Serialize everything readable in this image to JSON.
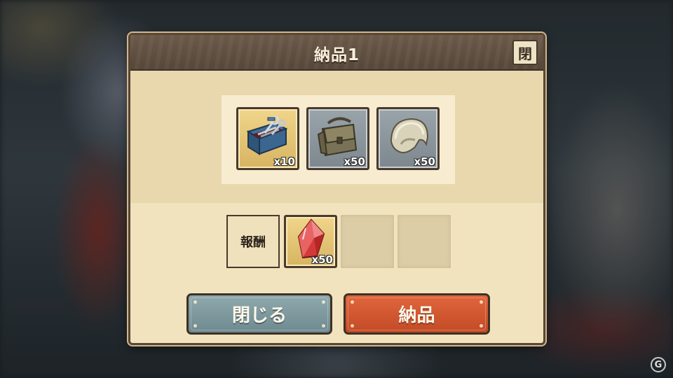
{
  "dialog": {
    "title": "納品1",
    "close_icon_label": "閉"
  },
  "required_items": [
    {
      "icon": "toolbox-icon",
      "quantity": "x10",
      "frame": "gold"
    },
    {
      "icon": "satchel-bag-icon",
      "quantity": "x50",
      "frame": "silver"
    },
    {
      "icon": "helmet-icon",
      "quantity": "x50",
      "frame": "silver"
    }
  ],
  "reward": {
    "label": "報酬",
    "items": [
      {
        "icon": "red-crystal-icon",
        "quantity": "x50"
      }
    ]
  },
  "buttons": {
    "close_label": "閉じる",
    "deliver_label": "納品"
  },
  "watermark": "G",
  "colors": {
    "close_button": "#7d979c",
    "deliver_button": "#d3572f",
    "title_bar": "#5f4f41",
    "panel": "#f1e3bd"
  }
}
